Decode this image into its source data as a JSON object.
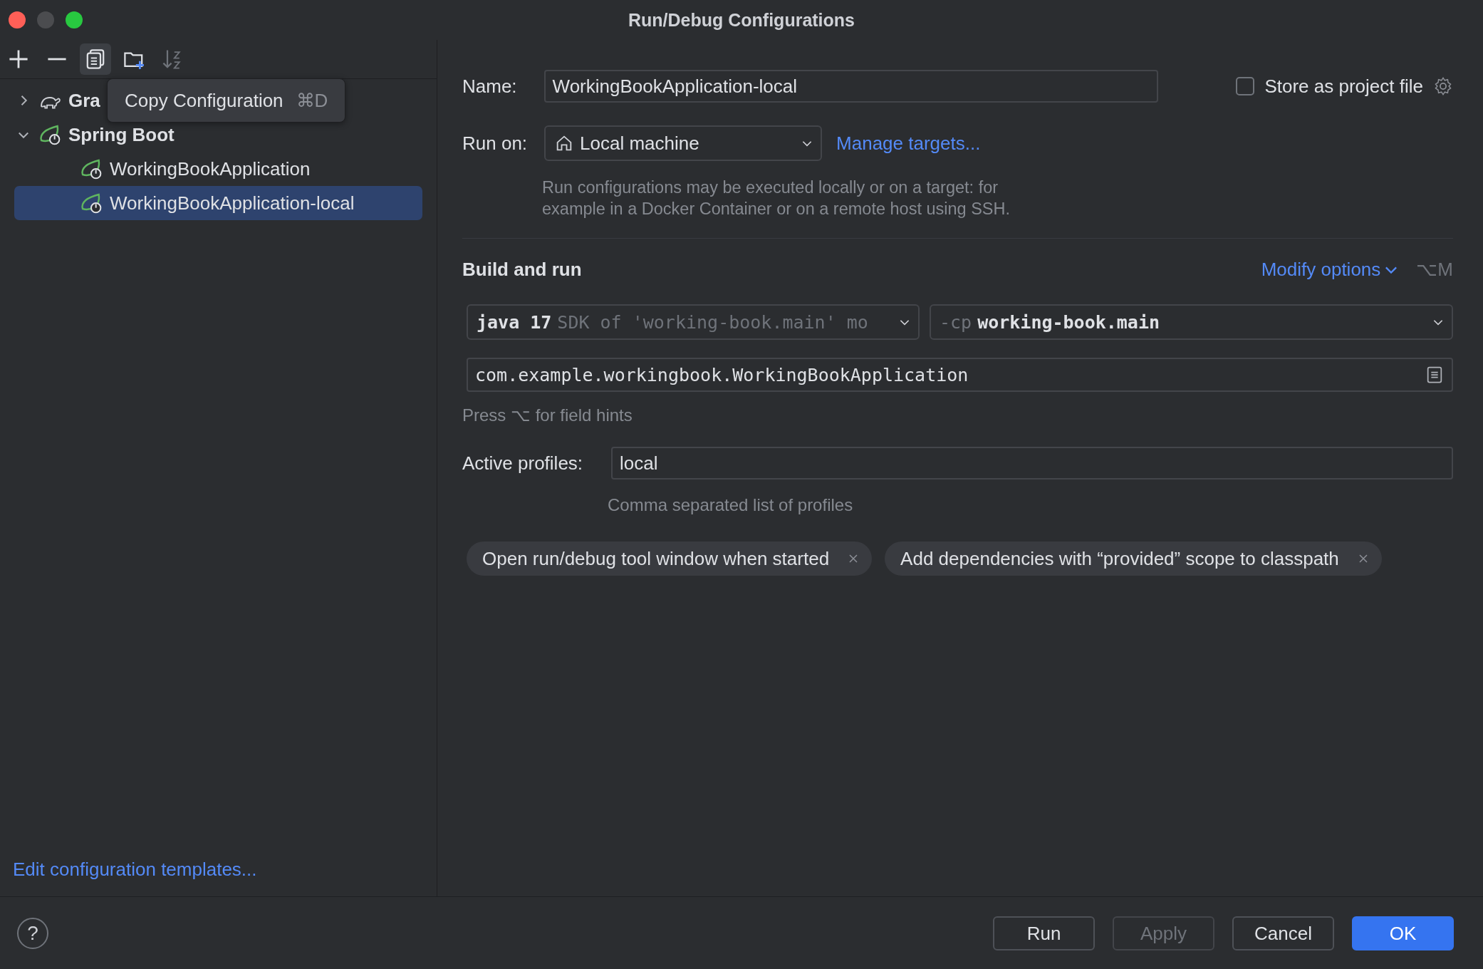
{
  "window": {
    "title": "Run/Debug Configurations"
  },
  "toolbar": [
    {
      "kind": "add",
      "hovered": false,
      "disabled": false
    },
    {
      "kind": "remove",
      "hovered": false,
      "disabled": false
    },
    {
      "kind": "copy",
      "hovered": true,
      "disabled": false
    },
    {
      "kind": "folder",
      "hovered": false,
      "disabled": false
    },
    {
      "kind": "sort",
      "hovered": false,
      "disabled": true
    }
  ],
  "tooltip": {
    "text": "Copy Configuration",
    "shortcut": "⌘D"
  },
  "tree": [
    {
      "label": "Gra",
      "kind": "gradle",
      "expanded": false,
      "selected": false
    },
    {
      "label": "Spring Boot",
      "kind": "spring",
      "expanded": true,
      "selected": false,
      "children": [
        {
          "label": "WorkingBookApplication",
          "kind": "spring",
          "selected": false
        },
        {
          "label": "WorkingBookApplication-local",
          "kind": "spring",
          "selected": true
        }
      ]
    }
  ],
  "templates_link": "Edit configuration templates...",
  "form": {
    "name": {
      "label": "Name:",
      "value": "WorkingBookApplication-local"
    },
    "store_as_project_file": {
      "label": "Store as project file",
      "checked": false
    },
    "run_on": {
      "label": "Run on:",
      "value": "Local machine",
      "link": "Manage targets...",
      "description": "Run configurations may be executed locally or on a target: for example in a Docker Container or on a remote host using SSH."
    },
    "section": "Build and run",
    "modify_options": {
      "label": "Modify options",
      "shortcut": "⌥M"
    },
    "jre": {
      "value": "java 17",
      "hint": "SDK of 'working-book.main' mo"
    },
    "classpath": {
      "prefix": "-cp",
      "value": "working-book.main"
    },
    "main_class": {
      "value": "com.example.workingbook.WorkingBookApplication"
    },
    "field_hint": "Press ⌥ for field hints",
    "active_profiles": {
      "label": "Active profiles:",
      "value": "local",
      "hint": "Comma separated list of profiles"
    },
    "chips": [
      {
        "label": "Open run/debug tool window when started"
      },
      {
        "label": "Add dependencies with “provided” scope to classpath"
      }
    ]
  },
  "footer": {
    "help": "?",
    "buttons": [
      {
        "label": "Run",
        "kind": "default",
        "disabled": false
      },
      {
        "label": "Apply",
        "kind": "default",
        "disabled": true
      },
      {
        "label": "Cancel",
        "kind": "default",
        "disabled": false
      },
      {
        "label": "OK",
        "kind": "primary",
        "disabled": false
      }
    ]
  }
}
